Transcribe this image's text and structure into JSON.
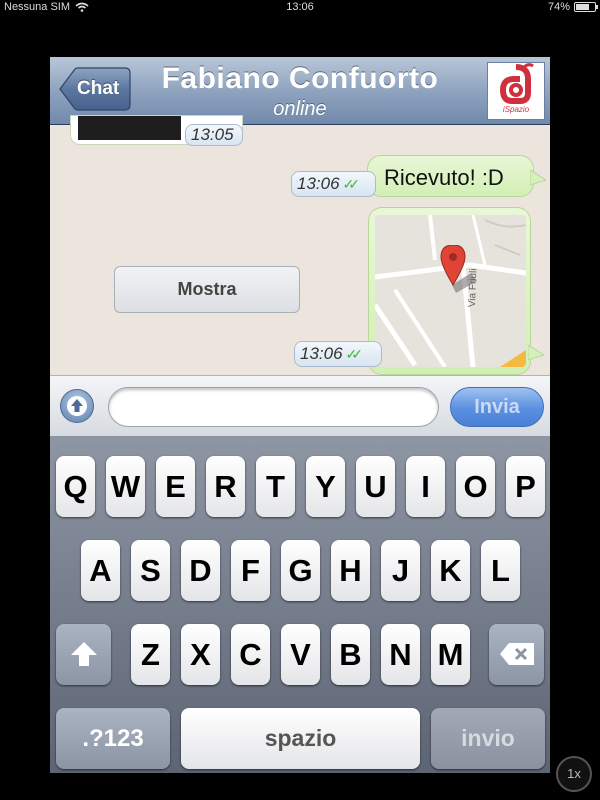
{
  "status_bar": {
    "carrier": "Nessuna SIM",
    "time": "13:06",
    "battery": "74%",
    "battery_level": 0.74
  },
  "nav": {
    "back_label": "Chat",
    "contact_name": "Fabiano Confuorto",
    "contact_status": "online",
    "avatar_logo_text": "iSpazio"
  },
  "messages": {
    "previous_time": "13:05",
    "text_message": "Ricevuto! :D",
    "text_time": "13:06",
    "location_time": "13:06",
    "map_street_label": "Via Friuli",
    "show_button_label": "Mostra"
  },
  "input_bar": {
    "placeholder": "",
    "send_label": "Invia"
  },
  "keyboard": {
    "row1": [
      "Q",
      "W",
      "E",
      "R",
      "T",
      "Y",
      "U",
      "I",
      "O",
      "P"
    ],
    "row2": [
      "A",
      "S",
      "D",
      "F",
      "G",
      "H",
      "J",
      "K",
      "L"
    ],
    "row3": [
      "Z",
      "X",
      "C",
      "V",
      "B",
      "N",
      "M"
    ],
    "numbers_label": ".?123",
    "space_label": "spazio",
    "enter_label": "invio"
  },
  "zoom_label": "1x",
  "colors": {
    "accent_blue": "#5b8fe0",
    "check_green": "#42b42d",
    "bubble_green": "#d2efb5",
    "chat_bg": "#ece5dd"
  }
}
